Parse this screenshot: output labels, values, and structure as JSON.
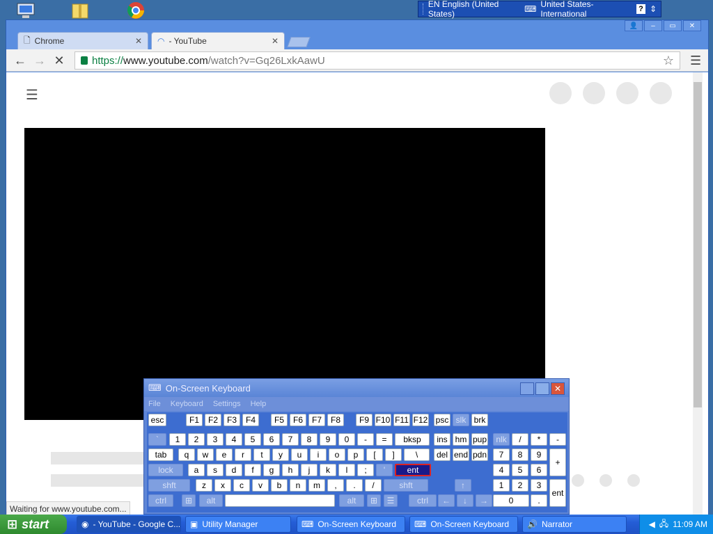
{
  "desktop": {
    "icons": [
      "computer-icon",
      "folder-icon",
      "chrome-icon"
    ],
    "language_bar": {
      "lang": "EN English (United States)",
      "layout": "United States-International"
    }
  },
  "browser": {
    "tabs": [
      {
        "label": "Chrome",
        "active": false
      },
      {
        "label": "- YouTube",
        "active": true
      }
    ],
    "url": {
      "scheme": "https://",
      "host": "www.youtube.com",
      "path": "/watch?v=Gq26LxkAawU"
    },
    "status": "Waiting for www.youtube.com..."
  },
  "osk": {
    "title": "On-Screen Keyboard",
    "menu": [
      "File",
      "Keyboard",
      "Settings",
      "Help"
    ],
    "keys": [
      [
        "esc",
        "F1",
        "F2",
        "F3",
        "F4",
        "F5",
        "F6",
        "F7",
        "F8",
        "F9",
        "F10",
        "F11",
        "F12",
        "psc",
        "slk",
        "brk"
      ],
      [
        "`",
        "1",
        "2",
        "3",
        "4",
        "5",
        "6",
        "7",
        "8",
        "9",
        "0",
        "-",
        "=",
        "bksp",
        "ins",
        "hm",
        "pup",
        "nlk",
        "/",
        "*",
        "-"
      ],
      [
        "tab",
        "q",
        "w",
        "e",
        "r",
        "t",
        "y",
        "u",
        "i",
        "o",
        "p",
        "[",
        "]",
        "\\",
        "del",
        "end",
        "pdn",
        "7",
        "8",
        "9",
        "+"
      ],
      [
        "lock",
        "a",
        "s",
        "d",
        "f",
        "g",
        "h",
        "j",
        "k",
        "l",
        ";",
        "'",
        "ent",
        "4",
        "5",
        "6"
      ],
      [
        "shft",
        "z",
        "x",
        "c",
        "v",
        "b",
        "n",
        "m",
        ",",
        ".",
        "/",
        "shft",
        "↑",
        "1",
        "2",
        "3",
        "ent"
      ],
      [
        "ctrl",
        "alt",
        "alt",
        "ctrl",
        "←",
        "↓",
        "→",
        "0",
        "."
      ]
    ]
  },
  "taskbar": {
    "start": "start",
    "tasks": [
      {
        "label": "- YouTube - Google C...",
        "icon": "chrome-icon"
      },
      {
        "label": "Utility Manager",
        "icon": "utility-icon"
      },
      {
        "label": "On-Screen Keyboard",
        "icon": "keyboard-icon"
      },
      {
        "label": "On-Screen Keyboard",
        "icon": "keyboard-icon"
      },
      {
        "label": "Narrator",
        "icon": "narrator-icon"
      }
    ],
    "clock": "11:09 AM"
  }
}
